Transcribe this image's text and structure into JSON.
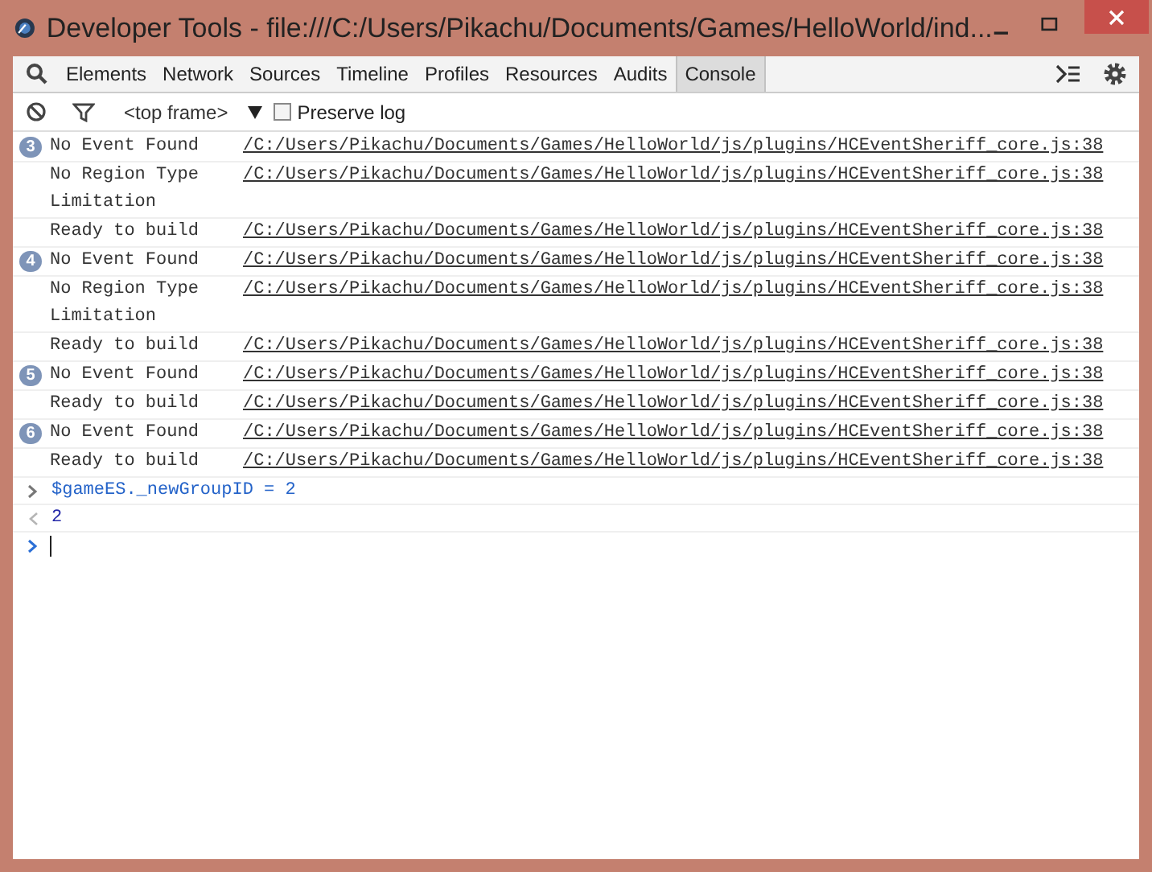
{
  "window": {
    "title": "Developer Tools - file:///C:/Users/Pikachu/Documents/Games/HelloWorld/ind..."
  },
  "tabs": [
    {
      "label": "Elements",
      "selected": false
    },
    {
      "label": "Network",
      "selected": false
    },
    {
      "label": "Sources",
      "selected": false
    },
    {
      "label": "Timeline",
      "selected": false
    },
    {
      "label": "Profiles",
      "selected": false
    },
    {
      "label": "Resources",
      "selected": false
    },
    {
      "label": "Audits",
      "selected": false
    },
    {
      "label": "Console",
      "selected": true
    }
  ],
  "console_toolbar": {
    "frame": "<top frame>",
    "preserve_log": {
      "label": "Preserve log",
      "checked": false
    }
  },
  "messages": [
    {
      "count": "3",
      "text": "No Event Found",
      "source": "/C:/Users/Pikachu/Documents/Games/HelloWorld/js/plugins/HCEventSheriff_core.js:38"
    },
    {
      "text": "No Region Type Limitation",
      "source": "/C:/Users/Pikachu/Documents/Games/HelloWorld/js/plugins/HCEventSheriff_core.js:38"
    },
    {
      "text": "Ready to build",
      "source": "/C:/Users/Pikachu/Documents/Games/HelloWorld/js/plugins/HCEventSheriff_core.js:38"
    },
    {
      "count": "4",
      "text": "No Event Found",
      "source": "/C:/Users/Pikachu/Documents/Games/HelloWorld/js/plugins/HCEventSheriff_core.js:38"
    },
    {
      "text": "No Region Type Limitation",
      "source": "/C:/Users/Pikachu/Documents/Games/HelloWorld/js/plugins/HCEventSheriff_core.js:38"
    },
    {
      "text": "Ready to build",
      "source": "/C:/Users/Pikachu/Documents/Games/HelloWorld/js/plugins/HCEventSheriff_core.js:38"
    },
    {
      "count": "5",
      "text": "No Event Found",
      "source": "/C:/Users/Pikachu/Documents/Games/HelloWorld/js/plugins/HCEventSheriff_core.js:38"
    },
    {
      "text": "Ready to build",
      "source": "/C:/Users/Pikachu/Documents/Games/HelloWorld/js/plugins/HCEventSheriff_core.js:38"
    },
    {
      "count": "6",
      "text": "No Event Found",
      "source": "/C:/Users/Pikachu/Documents/Games/HelloWorld/js/plugins/HCEventSheriff_core.js:38"
    },
    {
      "text": "Ready to build",
      "source": "/C:/Users/Pikachu/Documents/Games/HelloWorld/js/plugins/HCEventSheriff_core.js:38"
    }
  ],
  "history": [
    {
      "kind": "input",
      "text": "$gameES._newGroupID = 2"
    },
    {
      "kind": "result",
      "text": "2"
    }
  ]
}
